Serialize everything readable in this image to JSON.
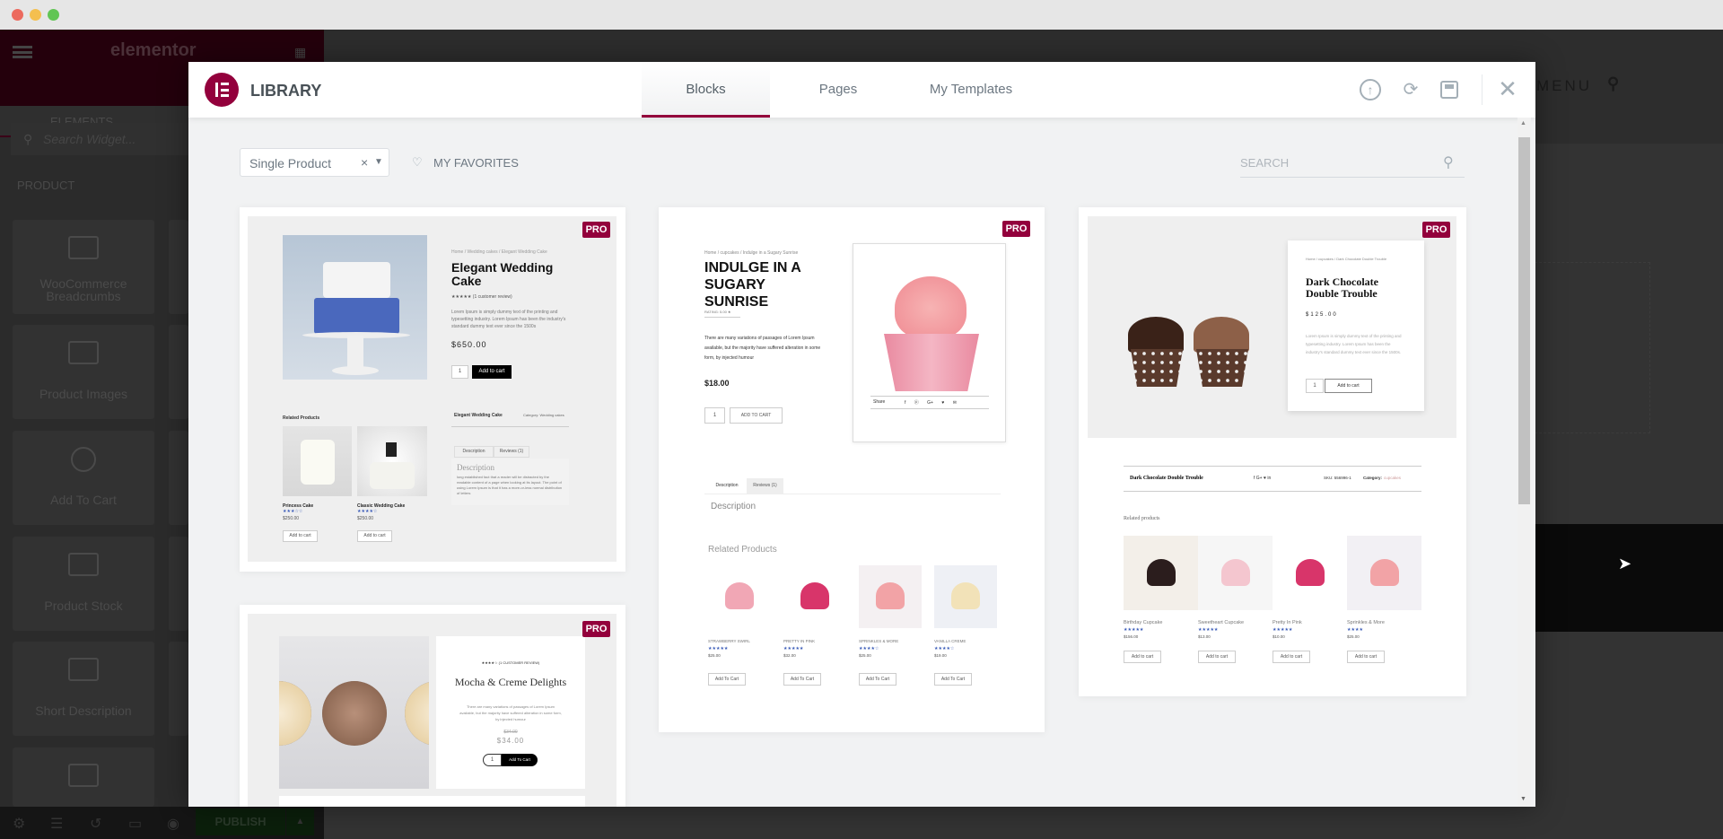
{
  "window": {
    "traffic_lights": [
      "#ec6a5e",
      "#f4bf4f",
      "#61c554"
    ]
  },
  "sidebar": {
    "logo": "elementor",
    "tab": "ELEMENTS",
    "search_placeholder": "Search Widget...",
    "category": "PRODUCT",
    "widgets": [
      {
        "label": "WooCommerce Breadcrumbs",
        "icon": "breadcrumbs-icon"
      },
      {
        "label": "Product Images",
        "icon": "product-images-icon"
      },
      {
        "label": "Add To Cart",
        "icon": "add-to-cart-icon"
      },
      {
        "label": "Product Stock",
        "icon": "product-stock-icon"
      },
      {
        "label": "Short Description",
        "icon": "short-description-icon"
      },
      {
        "label": "",
        "icon": "product-widget-icon"
      }
    ],
    "publish": "PUBLISH"
  },
  "canvas": {
    "menu": "MENU"
  },
  "library": {
    "title": "LIBRARY",
    "tabs": [
      {
        "label": "Blocks",
        "active": true
      },
      {
        "label": "Pages",
        "active": false
      },
      {
        "label": "My Templates",
        "active": false
      }
    ],
    "filter": {
      "value": "Single Product",
      "clear": "×"
    },
    "favorites": "MY FAVORITES",
    "search_placeholder": "SEARCH",
    "accent": "#93003c",
    "pro_badge": "PRO"
  },
  "cards": {
    "c1": {
      "breadcrumb": "Home / Wedding cakes / Elegant Wedding Cake",
      "title": "Elegant Wedding Cake",
      "reviews": "★★★★★ (1 customer review)",
      "desc": "Lorem Ipsum is simply dummy text of the printing and typesetting industry. Lorem Ipsum has been the industry's standard dummy text ever since the 1500s",
      "price": "$650.00",
      "qty": "1",
      "add": "Add to cart",
      "related": "Related Products",
      "meta_title": "Elegant Wedding Cake",
      "meta_cat": "Category: Wedding cakes",
      "tab1": "Description",
      "tab2": "Reviews (1)",
      "desc_h": "Description",
      "desc_text": "long established fact that a reader will be distracted by the readable content of a page when looking at its layout. The point of using Lorem Ipsum is that it has a more-or-less normal distribution of letters",
      "products": [
        {
          "name": "Princess Cake",
          "stars": "★★★☆☆",
          "price": "$250.00",
          "btn": "Add to cart"
        },
        {
          "name": "Classic Wedding Cake",
          "stars": "★★★★☆",
          "price": "$250.00",
          "btn": "Add to cart"
        }
      ]
    },
    "c2": {
      "breadcrumb": "Home / cupcakes / Indulge in a Sugary Sunrise",
      "title": "INDULGE IN A SUGARY SUNRISE",
      "rating": "RATING: 5.00 ★",
      "desc": "There are many variations of passages of Lorem Ipsum available, but the majority have suffered alteration in some form, by injected humour",
      "price": "$18.00",
      "qty": "1",
      "add": "ADD TO CART",
      "share": "Share",
      "share_icons": "f  ⓟ  G+  ♥  ✉",
      "tab1": "Description",
      "tab2": "Reviews (1)",
      "desc_h": "Description",
      "related": "Related Products",
      "products": [
        {
          "name": "STRAWBERRY SWIRL",
          "stars": "★★★★★",
          "price": "$25.00",
          "btn": "Add To Cart"
        },
        {
          "name": "PRETTY IN PINK",
          "stars": "★★★★★",
          "price": "$32.00",
          "btn": "Add To Cart"
        },
        {
          "name": "SPRINKLES & MORE",
          "stars": "★★★★☆",
          "price": "$25.00",
          "btn": "Add To Cart"
        },
        {
          "name": "VANILLA CREME",
          "stars": "★★★★☆",
          "price": "$19.00",
          "btn": "Add To Cart"
        }
      ]
    },
    "c3": {
      "breadcrumb": "Home / cupcakes / Dark Chocolate Double Trouble",
      "title": "Dark Chocolate Double Trouble",
      "price": "$125.00",
      "desc": "Lorem Ipsum is simply dummy text of the printing and typesetting industry. Lorem Ipsum has been the industry's standard dummy text ever since the 1500s.",
      "qty": "1",
      "add": "Add to cart",
      "meta_title": "Dark Chocolate Double Trouble",
      "social": "f   G+   ♥   in",
      "sku": "SKU: 556996-1",
      "cat_label": "Category:",
      "cat": "cupcakes",
      "related": "Related products",
      "products": [
        {
          "name": "Birthday Cupcake",
          "stars": "★★★★★",
          "price": "$156.00",
          "btn": "Add to cart"
        },
        {
          "name": "Sweetheart Cupcake",
          "stars": "★★★★★",
          "price": "$13.00",
          "btn": "Add to cart"
        },
        {
          "name": "Pretty In Pink",
          "stars": "★★★★★",
          "price": "$10.00",
          "btn": "Add to cart"
        },
        {
          "name": "Sprinkles & More",
          "stars": "★★★★",
          "price": "$25.00",
          "btn": "Add to cart"
        }
      ]
    },
    "c4": {
      "rating": "★★★★☆ (1 CUSTOMER REVIEW)",
      "title": "Mocha & Creme Delights",
      "desc": "There are many variations of passages of Lorem Ipsum available, but the majority have suffered alteration in some form, by injected humour",
      "old_price": "$34.00",
      "price": "$34.00",
      "qty": "1",
      "add": "Add To Cart"
    }
  }
}
